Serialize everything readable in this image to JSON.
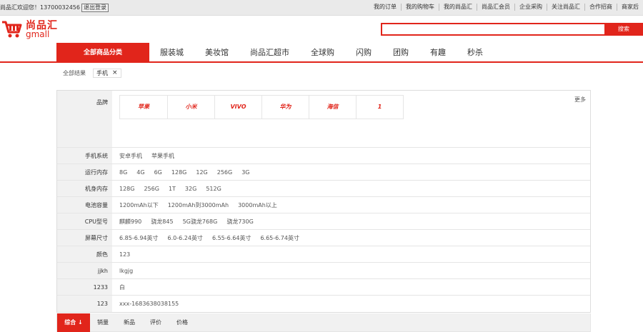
{
  "topbar": {
    "greeting": "尚品汇欢迎您！13700032456",
    "logout": "退出登录",
    "links": [
      "我的订单",
      "我的购物车",
      "我的尚品汇",
      "尚品汇会员",
      "企业采购",
      "关注尚品汇",
      "合作招商",
      "商家后"
    ]
  },
  "logo": {
    "cn": "尚品汇",
    "en": "gmall",
    "color": "#e1251b"
  },
  "search": {
    "value": "",
    "button": "搜索"
  },
  "nav": {
    "all_categories": "全部商品分类",
    "items": [
      "服装城",
      "美妆馆",
      "尚品汇超市",
      "全球购",
      "闪购",
      "团购",
      "有趣",
      "秒杀"
    ]
  },
  "crumb": {
    "root": "全部结果",
    "tag": "手机",
    "tag_close": "×"
  },
  "filter": {
    "brand_label": "品牌",
    "brands": [
      "苹果",
      "小米",
      "VIVO",
      "华为",
      "海信",
      "1"
    ],
    "more": "更多",
    "rows": [
      {
        "label": "手机系统",
        "values": [
          "安卓手机",
          "苹果手机"
        ]
      },
      {
        "label": "运行内存",
        "values": [
          "8G",
          "4G",
          "6G",
          "128G",
          "12G",
          "256G",
          "3G"
        ]
      },
      {
        "label": "机身内存",
        "values": [
          "128G",
          "256G",
          "1T",
          "32G",
          "512G"
        ]
      },
      {
        "label": "电池容量",
        "values": [
          "1200mAh以下",
          "1200mAh到3000mAh",
          "3000mAh以上"
        ]
      },
      {
        "label": "CPU型号",
        "values": [
          "麒麟990",
          "骁龙845",
          "5G骁龙768G",
          "骁龙730G"
        ]
      },
      {
        "label": "屏幕尺寸",
        "values": [
          "6.85-6.94英寸",
          "6.0-6.24英寸",
          "6.55-6.64英寸",
          "6.65-6.74英寸"
        ]
      },
      {
        "label": "颜色",
        "values": [
          "123"
        ]
      },
      {
        "label": "jjkh",
        "values": [
          "lkgjg"
        ]
      },
      {
        "label": "1233",
        "values": [
          "白"
        ]
      },
      {
        "label": "123",
        "values": [
          "xxx-1683638038155"
        ]
      }
    ]
  },
  "sort": {
    "active": "综合 ↓",
    "options": [
      "销量",
      "新品",
      "评价",
      "价格"
    ]
  }
}
